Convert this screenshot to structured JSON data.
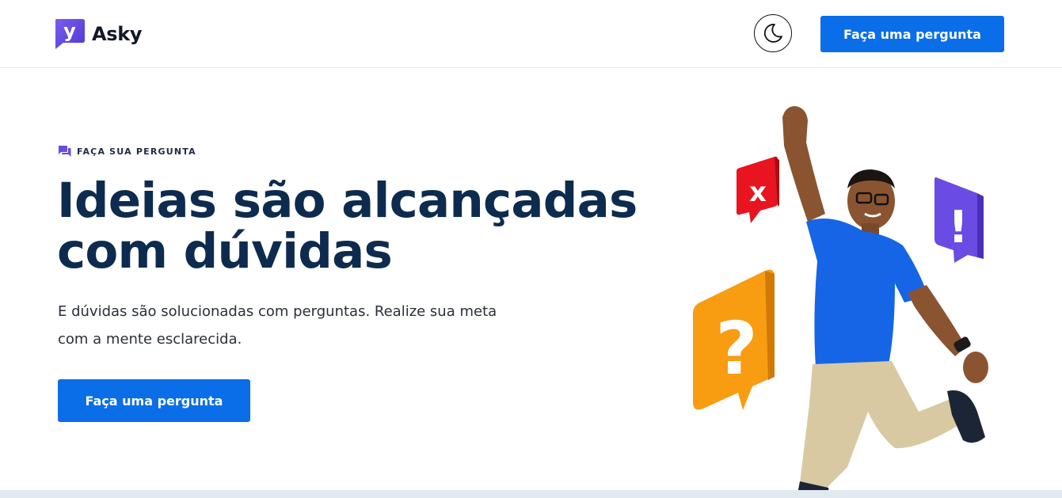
{
  "header": {
    "brand_name": "Asky",
    "brand_logo_letter": "y",
    "theme_toggle_icon": "moon-icon",
    "cta_label": "Faça uma pergunta"
  },
  "hero": {
    "eyebrow_icon": "chat-bubbles-icon",
    "eyebrow": "FAÇA SUA PERGUNTA",
    "title_line1": "Ideias são alcançadas",
    "title_line2": "com dúvidas",
    "text_line1": "E dúvidas são solucionadas com perguntas. Realize sua meta",
    "text_line2": "com a mente esclarecida.",
    "cta_label": "Faça uma pergunta"
  },
  "illustration": {
    "bubbles": [
      {
        "icon": "x-mark-icon",
        "glyph": "x",
        "color": "#e8141f"
      },
      {
        "icon": "exclamation-icon",
        "glyph": "!",
        "color": "#6a4be3"
      },
      {
        "icon": "question-mark-icon",
        "glyph": "?",
        "color": "#f89c12"
      }
    ],
    "figure_icon": "jumping-man-icon"
  },
  "colors": {
    "primary": "#0a6ee8",
    "title": "#0d2b4e",
    "brand_purple": "#6a4be3"
  }
}
